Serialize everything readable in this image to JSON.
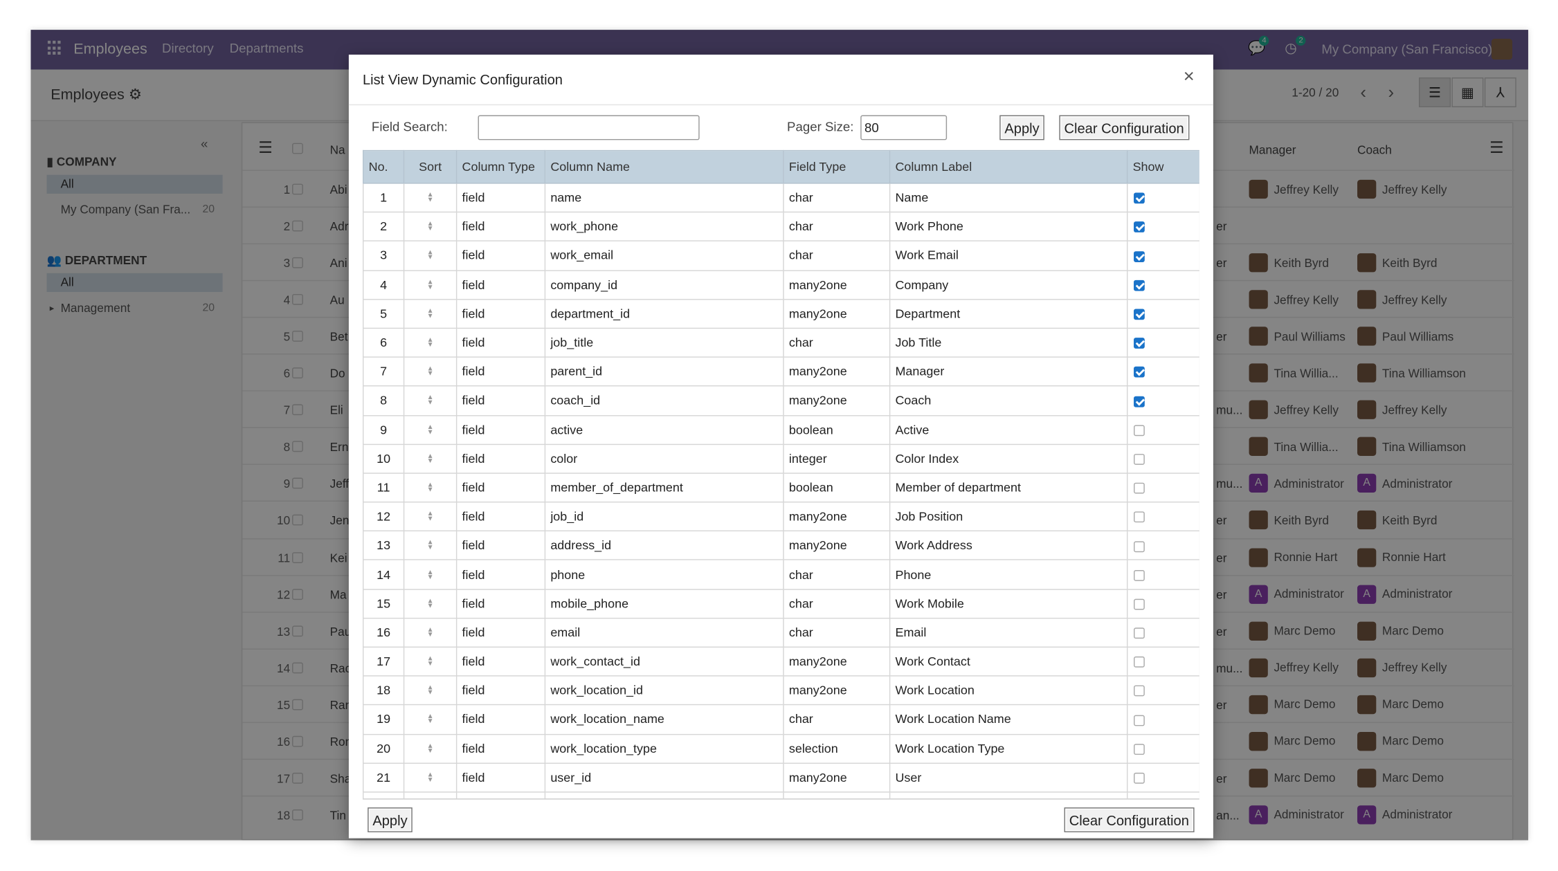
{
  "navbar": {
    "brand": "Employees",
    "menu": [
      "Directory",
      "Departments"
    ],
    "messages_count": "4",
    "activities_count": "2",
    "company": "My Company (San Francisco)"
  },
  "control": {
    "breadcrumb": "Employees",
    "pager": "1-20 / 20"
  },
  "sidebar": {
    "collapse": "«",
    "company_title": "COMPANY",
    "company_items": [
      {
        "label": "All",
        "count": ""
      },
      {
        "label": "My Company (San Fra...",
        "count": "20"
      }
    ],
    "department_title": "DEPARTMENT",
    "department_items": [
      {
        "label": "All",
        "count": ""
      },
      {
        "label": "Management",
        "count": "20"
      }
    ]
  },
  "list": {
    "columns": {
      "name": "Na",
      "manager": "Manager",
      "coach": "Coach"
    },
    "rows": [
      {
        "n": "1",
        "name": "Abi",
        "job": "",
        "mgr": "Jeffrey Kelly",
        "coach": "Jeffrey Kelly"
      },
      {
        "n": "2",
        "name": "Adr",
        "job": "er",
        "mgr": "",
        "coach": ""
      },
      {
        "n": "3",
        "name": "Ani",
        "job": "er",
        "mgr": "Keith Byrd",
        "coach": "Keith Byrd"
      },
      {
        "n": "4",
        "name": "Au",
        "job": "",
        "mgr": "Jeffrey Kelly",
        "coach": "Jeffrey Kelly"
      },
      {
        "n": "5",
        "name": "Bet",
        "job": "er",
        "mgr": "Paul Williams",
        "coach": "Paul Williams"
      },
      {
        "n": "6",
        "name": "Do",
        "job": "",
        "mgr": "Tina Willia...",
        "coach": "Tina Williamson"
      },
      {
        "n": "7",
        "name": "Eli",
        "job": "mu...",
        "mgr": "Jeffrey Kelly",
        "coach": "Jeffrey Kelly"
      },
      {
        "n": "8",
        "name": "Ern",
        "job": "",
        "mgr": "Tina Willia...",
        "coach": "Tina Williamson"
      },
      {
        "n": "9",
        "name": "Jeff",
        "job": "mu...",
        "mgr": "Administrator",
        "coach": "Administrator"
      },
      {
        "n": "10",
        "name": "Jen",
        "job": "er",
        "mgr": "Keith Byrd",
        "coach": "Keith Byrd"
      },
      {
        "n": "11",
        "name": "Kei",
        "job": "er",
        "mgr": "Ronnie Hart",
        "coach": "Ronnie Hart"
      },
      {
        "n": "12",
        "name": "Ma",
        "job": "er",
        "mgr": "Administrator",
        "coach": "Administrator"
      },
      {
        "n": "13",
        "name": "Pau",
        "job": "er",
        "mgr": "Marc Demo",
        "coach": "Marc Demo"
      },
      {
        "n": "14",
        "name": "Rac",
        "job": "mu...",
        "mgr": "Jeffrey Kelly",
        "coach": "Jeffrey Kelly"
      },
      {
        "n": "15",
        "name": "Ran",
        "job": "er",
        "mgr": "Marc Demo",
        "coach": "Marc Demo"
      },
      {
        "n": "16",
        "name": "Ron",
        "job": "",
        "mgr": "Marc Demo",
        "coach": "Marc Demo"
      },
      {
        "n": "17",
        "name": "Sha",
        "job": "er",
        "mgr": "Marc Demo",
        "coach": "Marc Demo"
      },
      {
        "n": "18",
        "name": "Tin",
        "job": "an...",
        "mgr": "Administrator",
        "coach": "Administrator"
      }
    ]
  },
  "colors": {
    "navbar": "#71639e",
    "checkbox_on": "#1a73c9",
    "table_header": "#c1d1dd",
    "admin_avatar": "#8e3fb5"
  },
  "modal": {
    "title": "List View Dynamic Configuration",
    "close": "×",
    "field_search_label": "Field Search:",
    "field_search_value": "",
    "pager_size_label": "Pager Size:",
    "pager_size_value": "80",
    "apply": "Apply",
    "clear": "Clear Configuration",
    "headers": [
      "No.",
      "Sort",
      "Column Type",
      "Column Name",
      "Field Type",
      "Column Label",
      "Show"
    ],
    "rows": [
      {
        "no": "1",
        "type": "field",
        "name": "name",
        "ftype": "char",
        "label": "Name",
        "show": true
      },
      {
        "no": "2",
        "type": "field",
        "name": "work_phone",
        "ftype": "char",
        "label": "Work Phone",
        "show": true
      },
      {
        "no": "3",
        "type": "field",
        "name": "work_email",
        "ftype": "char",
        "label": "Work Email",
        "show": true
      },
      {
        "no": "4",
        "type": "field",
        "name": "company_id",
        "ftype": "many2one",
        "label": "Company",
        "show": true
      },
      {
        "no": "5",
        "type": "field",
        "name": "department_id",
        "ftype": "many2one",
        "label": "Department",
        "show": true
      },
      {
        "no": "6",
        "type": "field",
        "name": "job_title",
        "ftype": "char",
        "label": "Job Title",
        "show": true
      },
      {
        "no": "7",
        "type": "field",
        "name": "parent_id",
        "ftype": "many2one",
        "label": "Manager",
        "show": true
      },
      {
        "no": "8",
        "type": "field",
        "name": "coach_id",
        "ftype": "many2one",
        "label": "Coach",
        "show": true
      },
      {
        "no": "9",
        "type": "field",
        "name": "active",
        "ftype": "boolean",
        "label": "Active",
        "show": false
      },
      {
        "no": "10",
        "type": "field",
        "name": "color",
        "ftype": "integer",
        "label": "Color Index",
        "show": false
      },
      {
        "no": "11",
        "type": "field",
        "name": "member_of_department",
        "ftype": "boolean",
        "label": "Member of department",
        "show": false
      },
      {
        "no": "12",
        "type": "field",
        "name": "job_id",
        "ftype": "many2one",
        "label": "Job Position",
        "show": false
      },
      {
        "no": "13",
        "type": "field",
        "name": "address_id",
        "ftype": "many2one",
        "label": "Work Address",
        "show": false
      },
      {
        "no": "14",
        "type": "field",
        "name": "phone",
        "ftype": "char",
        "label": "Phone",
        "show": false
      },
      {
        "no": "15",
        "type": "field",
        "name": "mobile_phone",
        "ftype": "char",
        "label": "Work Mobile",
        "show": false
      },
      {
        "no": "16",
        "type": "field",
        "name": "email",
        "ftype": "char",
        "label": "Email",
        "show": false
      },
      {
        "no": "17",
        "type": "field",
        "name": "work_contact_id",
        "ftype": "many2one",
        "label": "Work Contact",
        "show": false
      },
      {
        "no": "18",
        "type": "field",
        "name": "work_location_id",
        "ftype": "many2one",
        "label": "Work Location",
        "show": false
      },
      {
        "no": "19",
        "type": "field",
        "name": "work_location_name",
        "ftype": "char",
        "label": "Work Location Name",
        "show": false
      },
      {
        "no": "20",
        "type": "field",
        "name": "work_location_type",
        "ftype": "selection",
        "label": "Work Location Type",
        "show": false
      },
      {
        "no": "21",
        "type": "field",
        "name": "user_id",
        "ftype": "many2one",
        "label": "User",
        "show": false
      }
    ]
  }
}
